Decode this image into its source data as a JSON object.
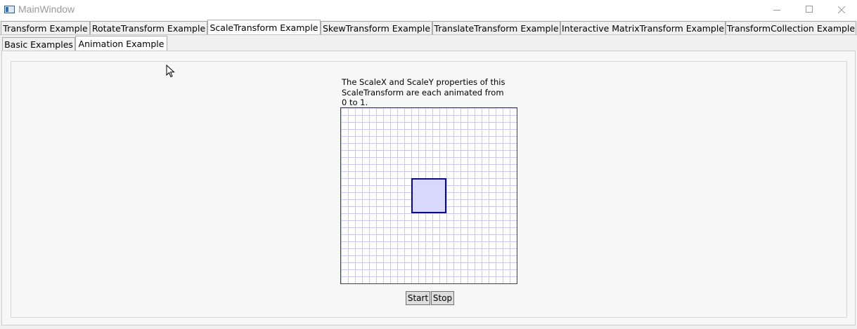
{
  "window": {
    "title": "MainWindow"
  },
  "tabs": [
    {
      "label": "Transform Example"
    },
    {
      "label": "RotateTransform Example"
    },
    {
      "label": "ScaleTransform Example"
    },
    {
      "label": "SkewTransform Example"
    },
    {
      "label": "TranslateTransform Example"
    },
    {
      "label": "Interactive MatrixTransform Example"
    },
    {
      "label": "TransformCollection Example"
    }
  ],
  "selected_tab": "ScaleTransform Example",
  "subtabs": [
    {
      "label": "Basic Examples"
    },
    {
      "label": "Animation Example"
    }
  ],
  "selected_subtab": "Animation Example",
  "content": {
    "description_line1": "The ScaleX and ScaleY properties of this",
    "description_line2": "ScaleTransform are each animated from",
    "description_line3": "0 to 1.",
    "start_label": "Start",
    "stop_label": "Stop"
  },
  "colors": {
    "tab_accent": "#f0c070",
    "square_stroke": "#0a0a8c",
    "square_fill": "#d8d8fb",
    "grid_line": "#c8c8f0"
  },
  "icons": {
    "app": "app-window-icon",
    "minimize": "minimize-icon",
    "maximize": "maximize-icon",
    "close": "close-icon",
    "cursor": "mouse-pointer-icon"
  }
}
